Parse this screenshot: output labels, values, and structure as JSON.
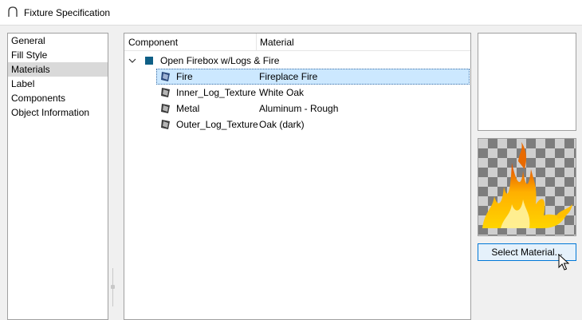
{
  "window": {
    "title": "Fixture Specification"
  },
  "nav": {
    "items": [
      {
        "label": "General"
      },
      {
        "label": "Fill Style"
      },
      {
        "label": "Materials",
        "selected": true
      },
      {
        "label": "Label"
      },
      {
        "label": "Components"
      },
      {
        "label": "Object Information"
      }
    ]
  },
  "tree": {
    "columns": {
      "component": "Component",
      "material": "Material"
    },
    "root": {
      "label": "Open Firebox w/Logs & Fire",
      "expanded": true,
      "icon": "component-square-icon",
      "color": "#0f5f86"
    },
    "rows": [
      {
        "component": "Fire",
        "material": "Fireplace Fire",
        "selected": true,
        "icon": "fire-material-icon"
      },
      {
        "component": "Inner_Log_Texture",
        "material": "White Oak",
        "icon": "material-icon"
      },
      {
        "component": "Metal",
        "material": "Aluminum - Rough",
        "icon": "material-icon"
      },
      {
        "component": "Outer_Log_Texture",
        "material": "Oak (dark)",
        "icon": "material-icon"
      }
    ]
  },
  "preview": {
    "image": "fireplace-fire-preview"
  },
  "buttons": {
    "select_material": "Select Material..."
  },
  "colors": {
    "accent": "#0078d7",
    "selection": "#cce8ff",
    "nav_selected": "#d9d9d9"
  }
}
